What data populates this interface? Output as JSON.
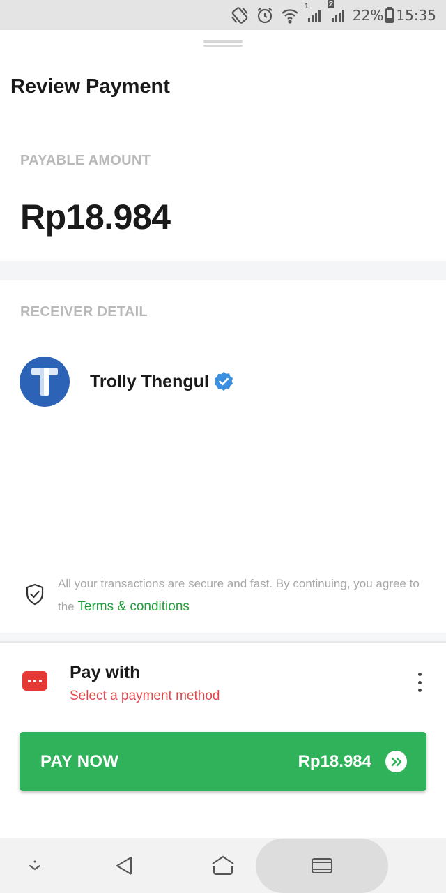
{
  "status_bar": {
    "signal_sim1_label": "1",
    "signal_sim2_label": "2",
    "battery": "22%",
    "time": "15:35"
  },
  "header": {
    "title": "Review Payment"
  },
  "payable": {
    "label": "PAYABLE AMOUNT",
    "amount": "Rp18.984"
  },
  "receiver": {
    "label": "RECEIVER DETAIL",
    "name": "Trolly Thengul",
    "avatar_color": "#2d63b6",
    "verified": true
  },
  "secure_note": {
    "text": "All your transactions are secure and fast. By continuing, you agree to the",
    "link": "Terms & conditions"
  },
  "payment_method": {
    "title": "Pay with",
    "subtitle": "Select a payment method",
    "icon": "dots-icon",
    "icon_color": "#e53935"
  },
  "pay_now": {
    "label": "PAY NOW",
    "amount": "Rp18.984",
    "color": "#30b25b"
  },
  "nav_bar": {
    "buttons": [
      "hide-keyboard-icon",
      "back-icon",
      "home-icon",
      "recents-icon"
    ]
  }
}
